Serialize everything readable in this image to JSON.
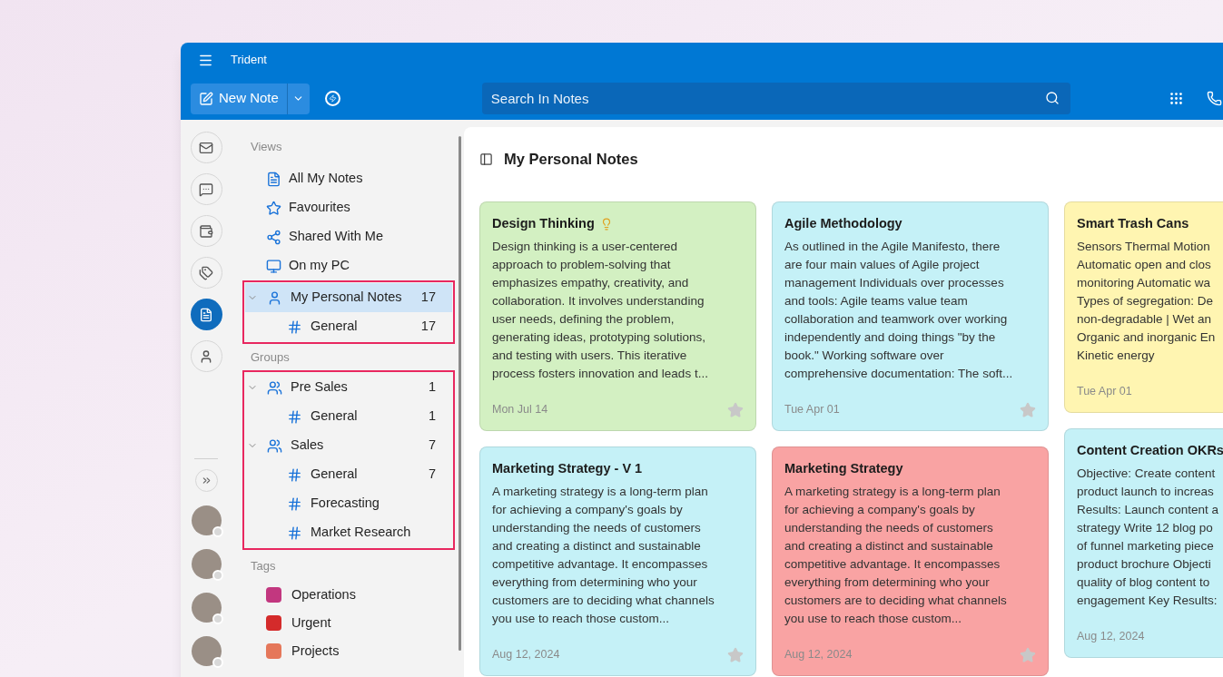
{
  "window": {
    "title": "Trident"
  },
  "toolbar": {
    "new_note": "New Note",
    "search": {
      "placeholder": "Search In Notes"
    }
  },
  "rail_items": [
    {
      "selected": false
    },
    {
      "selected": false
    },
    {
      "selected": false
    },
    {
      "selected": false
    },
    {
      "selected": true
    },
    {
      "selected": false
    }
  ],
  "views": {
    "label": "Views",
    "items": [
      {
        "label": "All My Notes"
      },
      {
        "label": "Favourites"
      },
      {
        "label": "Shared With Me"
      },
      {
        "label": "On my PC"
      }
    ]
  },
  "personal": {
    "highlighted": true,
    "items": [
      {
        "label": "My Personal Notes",
        "count": "17",
        "selected": true,
        "expanded": true,
        "children": [
          {
            "label": "General",
            "count": "17",
            "selected": false
          }
        ]
      }
    ]
  },
  "groups": {
    "label": "Groups",
    "highlighted": true,
    "items": [
      {
        "label": "Pre Sales",
        "count": "1",
        "selected": false,
        "expanded": true,
        "children": [
          {
            "label": "General",
            "count": "1",
            "selected": false
          }
        ]
      },
      {
        "label": "Sales",
        "count": "7",
        "selected": false,
        "expanded": true,
        "children": [
          {
            "label": "General",
            "count": "7",
            "selected": false
          },
          {
            "label": "Forecasting",
            "selected": false
          },
          {
            "label": "Market Research",
            "selected": false
          }
        ]
      }
    ]
  },
  "tags": {
    "label": "Tags",
    "items": [
      {
        "label": "Operations",
        "color": "#c2377f"
      },
      {
        "label": "Urgent",
        "color": "#d42b2b"
      },
      {
        "label": "Projects",
        "color": "#e5775a"
      }
    ]
  },
  "content": {
    "title": "My Personal Notes",
    "columns": [
      [
        {
          "title": "Design Thinking",
          "bulb": true,
          "color": "#d3f0c2",
          "starred": false,
          "date": "Mon Jul 14",
          "lines": [
            "Design thinking is a user-centered",
            "approach to problem-solving that",
            "emphasizes empathy, creativity, and",
            "collaboration. It involves understanding",
            "user needs, defining the problem,",
            "generating ideas, prototyping solutions,",
            "and testing with users. This iterative",
            "process fosters innovation and leads t..."
          ]
        },
        {
          "title": "Marketing Strategy - V 1",
          "bulb": false,
          "color": "#c5f1f7",
          "starred": false,
          "date": "Aug 12, 2024",
          "lines": [
            "A marketing strategy is a long-term plan",
            "for achieving a company's goals by",
            "understanding the needs of customers",
            "and creating a distinct and sustainable",
            "competitive advantage. It encompasses",
            "everything from determining who your",
            "customers are to deciding what channels",
            "you use to reach those custom..."
          ]
        }
      ],
      [
        {
          "title": "Agile Methodology",
          "bulb": false,
          "color": "#c5f1f7",
          "starred": false,
          "date": "Tue Apr 01",
          "lines": [
            "As outlined in the Agile Manifesto, there",
            "are four main values of Agile project",
            "management Individuals over processes",
            "and tools: Agile teams value team",
            "collaboration and teamwork over working",
            "independently and doing things \"by the",
            "book.\" Working software over",
            "comprehensive documentation: The soft..."
          ]
        },
        {
          "title": "Marketing Strategy",
          "bulb": false,
          "color": "#f9a3a3",
          "starred": false,
          "date": "Aug 12, 2024",
          "lines": [
            "A marketing strategy is a long-term plan",
            "for achieving a company's goals by",
            "understanding the needs of customers",
            "and creating a distinct and sustainable",
            "competitive advantage. It encompasses",
            "everything from determining who your",
            "customers are to deciding what channels",
            "you use to reach those custom..."
          ]
        }
      ],
      [
        {
          "title": "Smart Trash Cans",
          "bulb": false,
          "color": "#fff5b1",
          "date": "Tue Apr 01",
          "lines": [
            "Sensors Thermal Motion",
            "Automatic open and clos",
            "monitoring Automatic wa",
            "Types of segregation: De",
            "non-degradable | Wet an",
            "Organic and inorganic En",
            "Kinetic energy"
          ]
        },
        {
          "title": "Content Creation OKRs",
          "bulb": false,
          "color": "#c5f1f7",
          "date": "Aug 12, 2024",
          "lines": [
            "Objective: Create content",
            "product launch to increas",
            "Results: Launch content a",
            "strategy Write 12 blog po",
            "of funnel marketing piece",
            "product brochure Objecti",
            "quality of blog content to",
            "engagement Key Results:"
          ]
        }
      ]
    ]
  }
}
